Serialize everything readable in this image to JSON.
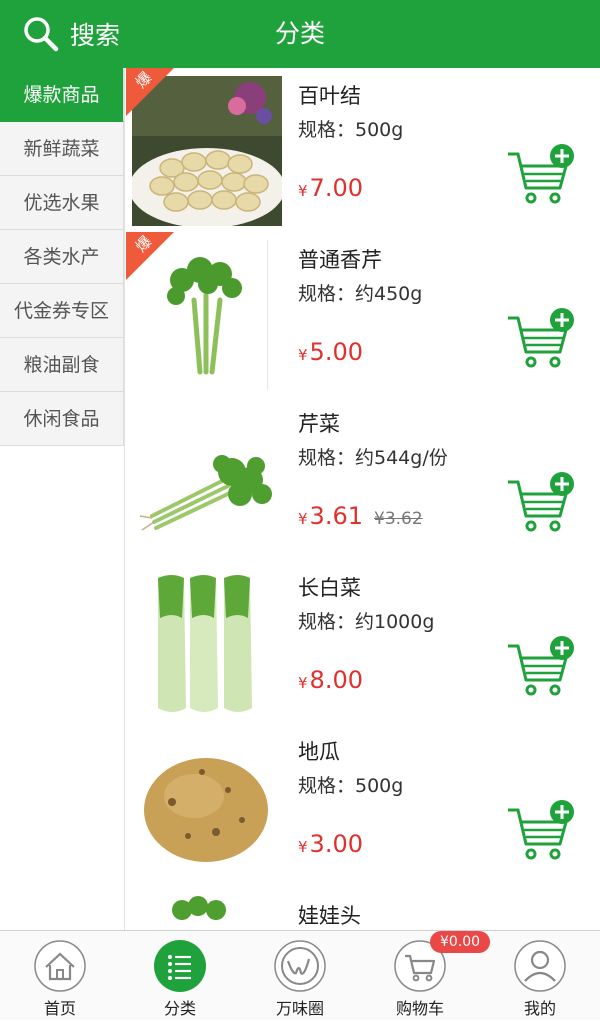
{
  "header": {
    "search_label": "搜索",
    "title": "分类"
  },
  "sidebar": {
    "items": [
      {
        "label": "爆款商品",
        "active": true
      },
      {
        "label": "新鲜蔬菜"
      },
      {
        "label": "优选水果"
      },
      {
        "label": "各类水产"
      },
      {
        "label": "代金券专区"
      },
      {
        "label": "粮油副食"
      },
      {
        "label": "休闲食品"
      }
    ]
  },
  "products": [
    {
      "name": "百叶结",
      "spec": "规格：500g",
      "price": "7.00",
      "badge": "爆",
      "image": "tofu-knots-image"
    },
    {
      "name": "普通香芹",
      "spec": "规格：约450g",
      "price": "5.00",
      "badge": "爆",
      "image": "celery-image"
    },
    {
      "name": "芹菜",
      "spec": "规格：约544g/份",
      "price": "3.61",
      "old_price": "¥3.62",
      "image": "celery-bunch-image"
    },
    {
      "name": "长白菜",
      "spec": "规格：约1000g",
      "price": "8.00",
      "image": "napa-cabbage-image"
    },
    {
      "name": "地瓜",
      "spec": "规格：500g",
      "price": "3.00",
      "image": "jicama-image"
    },
    {
      "name": "娃娃头",
      "image": "baby-cabbage-image"
    }
  ],
  "currency": "¥",
  "bottom_nav": {
    "items": [
      {
        "label": "首页",
        "icon": "home-icon"
      },
      {
        "label": "分类",
        "icon": "list-icon",
        "active": true
      },
      {
        "label": "万味圈",
        "icon": "circle-logo-icon"
      },
      {
        "label": "购物车",
        "icon": "cart-icon"
      },
      {
        "label": "我的",
        "icon": "user-icon"
      }
    ],
    "cart_total": "¥0.00"
  },
  "colors": {
    "brand_green": "#1fa13c",
    "price_red": "#e0312f",
    "badge_orange": "#ef5a3a",
    "badge_red": "#ea4747"
  }
}
